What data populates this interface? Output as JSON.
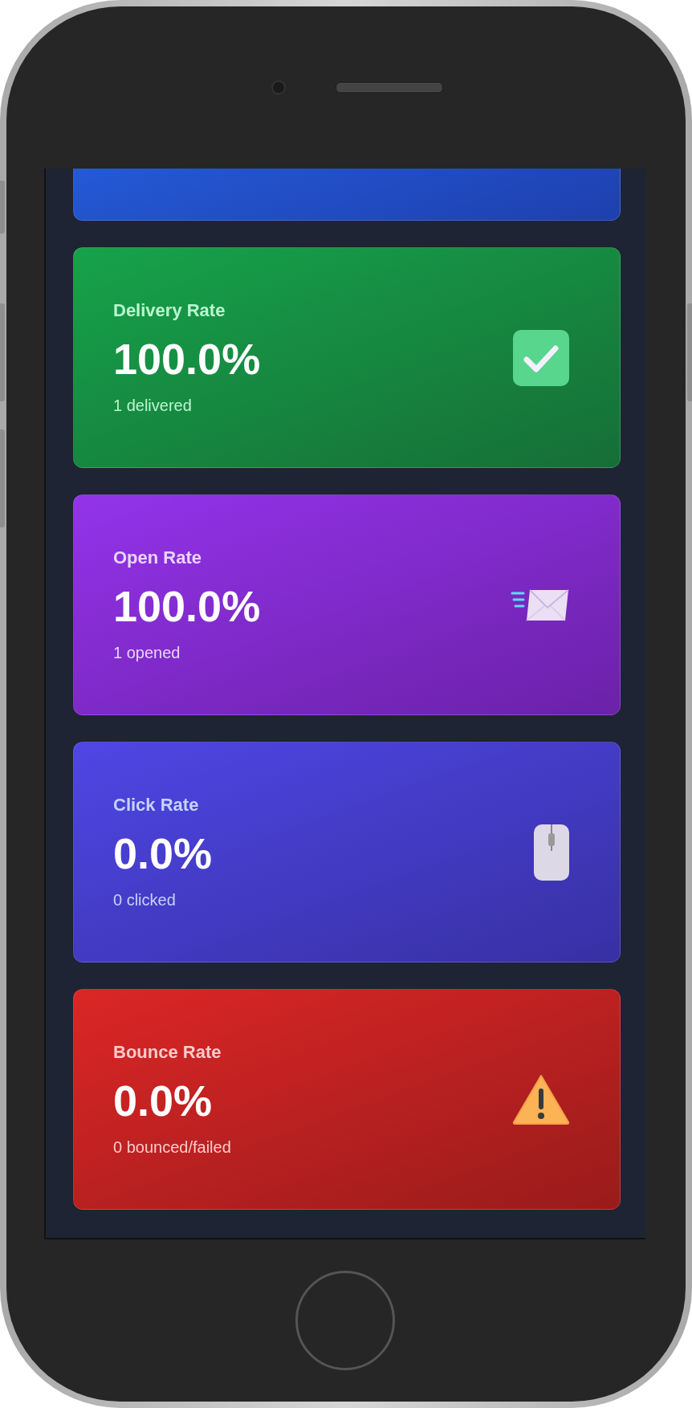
{
  "cards": [
    {
      "kind": "partial"
    },
    {
      "kind": "delivery",
      "label": "Delivery Rate",
      "value": "100.0%",
      "detail": "1 delivered"
    },
    {
      "kind": "open",
      "label": "Open Rate",
      "value": "100.0%",
      "detail": "1 opened"
    },
    {
      "kind": "click",
      "label": "Click Rate",
      "value": "0.0%",
      "detail": "0 clicked"
    },
    {
      "kind": "bounce",
      "label": "Bounce Rate",
      "value": "0.0%",
      "detail": "0 bounced/failed"
    }
  ]
}
